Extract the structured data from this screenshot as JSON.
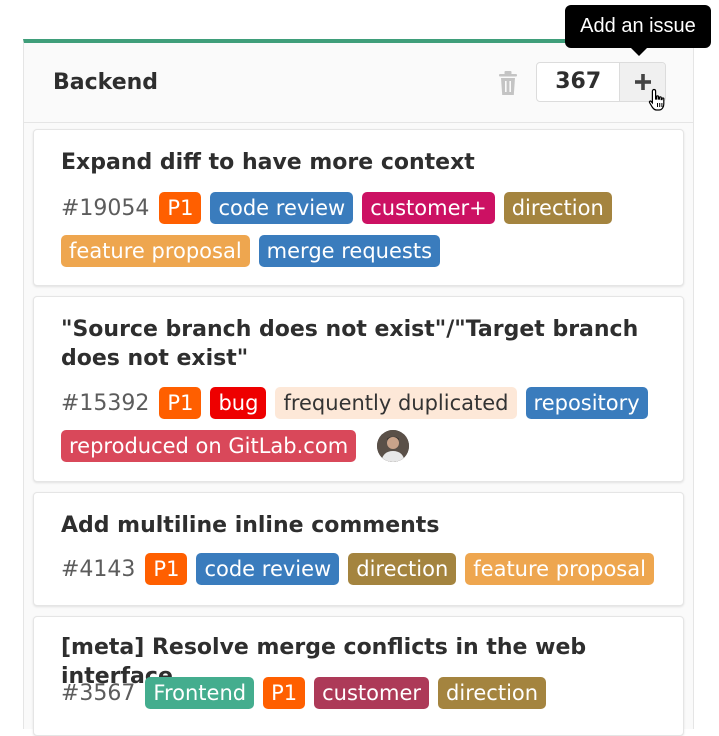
{
  "tooltip": "Add an issue",
  "board": {
    "title": "Backend",
    "count": "367",
    "icons": {
      "delete": "trash-icon",
      "add": "plus-icon",
      "pointer": "hand-cursor-icon"
    },
    "accent_color": "#3f9e7a"
  },
  "label_colors": {
    "P1": "#ff5f00",
    "bug": "#ee0000",
    "code review": "#3a7cbd",
    "customer+": "#cc1163",
    "customer": "#ad3a58",
    "direction": "#a4843f",
    "feature proposal": "#eea64f",
    "merge requests": "#3a7cbd",
    "frequently duplicated": "#fde8d8",
    "repository": "#3a7cbd",
    "reproduced on GitLab.com": "#d9485a",
    "Frontend": "#44ad8e"
  },
  "cards": [
    {
      "title": "Expand diff to have more context",
      "ref": "#19054",
      "row1": [
        "P1",
        "code review",
        "customer+",
        "direction"
      ],
      "row2": [
        "feature proposal",
        "merge requests"
      ]
    },
    {
      "title": "\"Source branch does not exist\"/\"Target branch does not exist\"",
      "ref": "#15392",
      "row1": [
        "P1",
        "bug",
        "frequently duplicated",
        "repository"
      ],
      "row2": [
        "reproduced on GitLab.com"
      ],
      "has_avatar": true
    },
    {
      "title": "Add multiline inline comments",
      "ref": "#4143",
      "row1": [
        "P1",
        "code review",
        "direction",
        "feature proposal"
      ]
    },
    {
      "title": "[meta] Resolve merge conflicts in the web interface",
      "ref": "#3567",
      "row1": [
        "Frontend",
        "P1",
        "customer",
        "direction"
      ]
    }
  ]
}
